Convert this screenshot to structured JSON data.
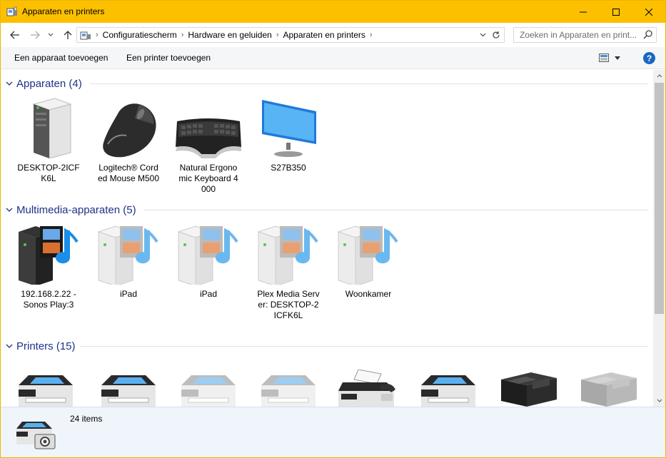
{
  "window": {
    "title": "Apparaten en printers",
    "accent_color": "#fdc000"
  },
  "address": {
    "breadcrumbs": [
      "Configuratiescherm",
      "Hardware en geluiden",
      "Apparaten en printers"
    ],
    "search_placeholder": "Zoeken in Apparaten en print..."
  },
  "toolbar": {
    "add_device": "Een apparaat toevoegen",
    "add_printer": "Een printer toevoegen",
    "help": "?"
  },
  "groups": [
    {
      "title": "Apparaten (4)",
      "items": [
        {
          "label": "DESKTOP-2ICFK6L",
          "icon": "computer-tower-icon"
        },
        {
          "label": "Logitech® Corded Mouse M500",
          "icon": "mouse-icon"
        },
        {
          "label": "Natural Ergonomic Keyboard 4000",
          "icon": "keyboard-icon"
        },
        {
          "label": "S27B350",
          "icon": "monitor-icon"
        }
      ]
    },
    {
      "title": "Multimedia-apparaten (5)",
      "items": [
        {
          "label": "192.168.2.22 - Sonos Play:3",
          "icon": "media-device-icon"
        },
        {
          "label": "iPad",
          "icon": "media-device-icon"
        },
        {
          "label": "iPad",
          "icon": "media-device-icon"
        },
        {
          "label": "Plex Media Server: DESKTOP-2ICFK6L",
          "icon": "media-device-icon"
        },
        {
          "label": "Woonkamer",
          "icon": "media-device-icon"
        }
      ]
    },
    {
      "title": "Printers (15)",
      "items": [
        {
          "label": "",
          "icon": "printer-icon"
        },
        {
          "label": "",
          "icon": "printer-icon"
        },
        {
          "label": "",
          "icon": "printer-icon"
        },
        {
          "label": "",
          "icon": "printer-icon"
        },
        {
          "label": "",
          "icon": "fax-icon"
        },
        {
          "label": "",
          "icon": "printer-icon"
        },
        {
          "label": "",
          "icon": "multifunction-printer-icon"
        },
        {
          "label": "",
          "icon": "multifunction-printer-icon"
        }
      ]
    }
  ],
  "details": {
    "count": "24 items"
  }
}
